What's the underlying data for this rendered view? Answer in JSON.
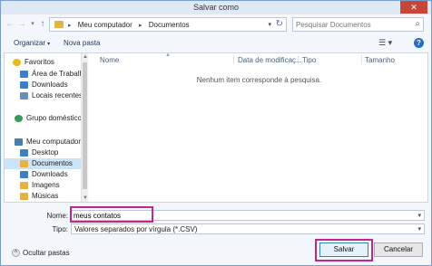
{
  "window": {
    "title": "Salvar como",
    "close_glyph": "✕"
  },
  "address": {
    "crumbs": [
      "Meu computador",
      "Documentos"
    ],
    "separator": "▸",
    "dropdown_glyph": "▾",
    "refresh_glyph": "↻"
  },
  "nav_buttons": {
    "back": "←",
    "forward": "→",
    "recent": "▾",
    "up": "↑"
  },
  "search": {
    "placeholder": "Pesquisar Documentos",
    "icon": "search-icon",
    "glyph": "⌕"
  },
  "toolbar": {
    "organize_label": "Organizar",
    "organize_caret": "▾",
    "new_folder_label": "Nova pasta",
    "view_glyph": "☰ ▾",
    "help_glyph": "?"
  },
  "nav_pane": {
    "groups": [
      {
        "label": "Favoritos",
        "icon": "star-icon",
        "color": "#e8b923",
        "children": [
          {
            "label": "Área de Trabalho",
            "icon": "desktop-icon",
            "color": "#3f7ec1"
          },
          {
            "label": "Downloads",
            "icon": "downloads-icon",
            "color": "#3f7ec1"
          },
          {
            "label": "Locais recentes",
            "icon": "recent-places-icon",
            "color": "#6d8fb4"
          }
        ]
      },
      {
        "label": "Grupo doméstico",
        "icon": "homegroup-icon",
        "color": "#3a9a5b",
        "children": []
      },
      {
        "label": "Meu computador",
        "icon": "computer-icon",
        "color": "#4f7bab",
        "children": [
          {
            "label": "Desktop",
            "icon": "desktop-icon",
            "color": "#3f7ec1"
          },
          {
            "label": "Documentos",
            "icon": "documents-icon",
            "color": "#e3b348",
            "selected": true
          },
          {
            "label": "Downloads",
            "icon": "downloads-icon",
            "color": "#3f7ec1"
          },
          {
            "label": "Imagens",
            "icon": "pictures-icon",
            "color": "#e3b348"
          },
          {
            "label": "Músicas",
            "icon": "music-icon",
            "color": "#e3b348"
          }
        ]
      }
    ]
  },
  "file_list": {
    "columns": [
      "Nome",
      "Data de modificaç...",
      "Tipo",
      "Tamanho"
    ],
    "sort_arrow": "▲",
    "empty_message": "Nenhum item corresponde à pesquisa."
  },
  "save_form": {
    "name_label": "Nome:",
    "name_value": "meus contatos",
    "type_label": "Tipo:",
    "type_value": "Valores separados por vírgula (*.CSV)",
    "dropdown_glyph": "▾"
  },
  "footer": {
    "hide_folders_label": "Ocultar pastas",
    "hide_folders_glyph": "˄",
    "save_label": "Salvar",
    "cancel_label": "Cancelar"
  },
  "colors": {
    "highlight": "#c0268e",
    "accent": "#3c7fb1",
    "close": "#c7463a"
  }
}
